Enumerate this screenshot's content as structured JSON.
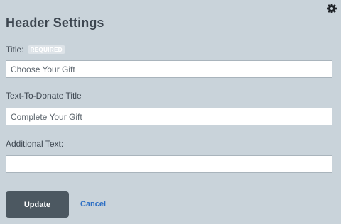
{
  "header": {
    "title": "Header Settings",
    "settings_icon": "gear-icon"
  },
  "fields": {
    "title": {
      "label": "Title:",
      "badge": "REQUIRED",
      "value": "Choose Your Gift"
    },
    "text_to_donate_title": {
      "label": "Text-To-Donate Title",
      "value": "Complete Your Gift"
    },
    "additional_text": {
      "label": "Additional Text:",
      "value": ""
    }
  },
  "actions": {
    "update_label": "Update",
    "cancel_label": "Cancel"
  },
  "colors": {
    "background": "#c9d3da",
    "primary_button": "#4c5861",
    "link": "#2d6fc4"
  }
}
